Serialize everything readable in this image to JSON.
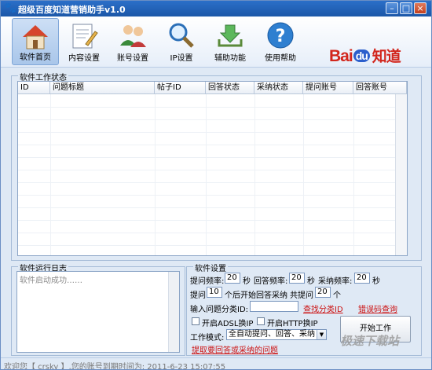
{
  "window": {
    "title": "超级百度知道营销助手v1.0"
  },
  "toolbar": {
    "items": [
      {
        "label": "软件首页",
        "icon": "home-icon"
      },
      {
        "label": "内容设置",
        "icon": "document-pen-icon"
      },
      {
        "label": "账号设置",
        "icon": "users-icon"
      },
      {
        "label": "IP设置",
        "icon": "magnifier-icon"
      },
      {
        "label": "辅助功能",
        "icon": "download-arrow-icon"
      },
      {
        "label": "使用帮助",
        "icon": "help-question-icon"
      }
    ],
    "logo": {
      "bai": "Bai",
      "du": "du",
      "zhidao": "知道"
    }
  },
  "work_status": {
    "title": "软件工作状态",
    "columns": [
      "ID",
      "问题标题",
      "帖子ID",
      "回答状态",
      "采纳状态",
      "提问账号",
      "回答账号"
    ]
  },
  "log": {
    "title": "软件运行日志",
    "text": "软件启动成功……"
  },
  "settings": {
    "title": "软件设置",
    "ask_freq_label": "提问频率:",
    "ask_freq_value": "20",
    "ans_freq_label": "回答频率:",
    "ans_freq_value": "20",
    "adopt_freq_label": "采纳频率:",
    "adopt_freq_value": "20",
    "sec": "秒",
    "ask_label": "提问",
    "ask_value": "10",
    "after_label": "个后开始回答采纳",
    "total_label": "共提问",
    "total_value": "20",
    "unit_ge": "个",
    "category_label": "输入问题分类ID:",
    "category_value": "",
    "find_category_link": "查找分类ID",
    "error_code_link": "错误码查询",
    "adsl_label": "开启ADSL换IP",
    "http_label": "开启HTTP换IP",
    "mode_label": "工作模式:",
    "mode_value": "全自动提问、回答、采纳",
    "question_link": "提取要回答或采纳的问题",
    "start_button": "开始工作"
  },
  "status": {
    "text": "欢迎您【 crsky 】,您的账号到期时间为: 2011-6-23 15:07:55"
  },
  "watermark": "极速下载站"
}
